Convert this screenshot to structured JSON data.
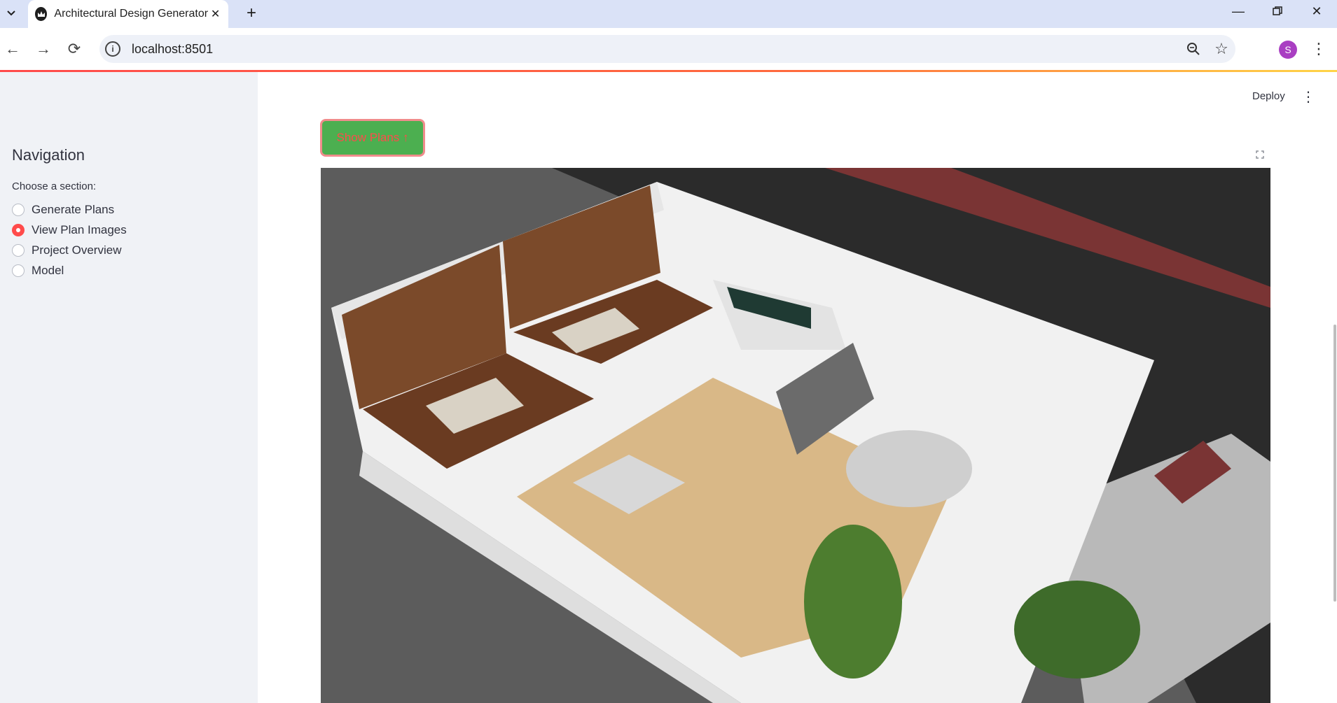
{
  "browser": {
    "tab_title": "Architectural Design Generator",
    "url": "localhost:8501",
    "profile_initial": "S"
  },
  "sidebar": {
    "title": "Navigation",
    "radio_label": "Choose a section:",
    "options": [
      {
        "label": "Generate Plans",
        "selected": false
      },
      {
        "label": "View Plan Images",
        "selected": true
      },
      {
        "label": "Project Overview",
        "selected": false
      },
      {
        "label": "Model",
        "selected": false
      }
    ]
  },
  "header": {
    "deploy_label": "Deploy"
  },
  "main": {
    "show_button_label": "Show Plans ↑",
    "image_alt": "3D isometric cutaway render of a house floor plan"
  },
  "colors": {
    "accent": "#ff4b4b",
    "button_green": "#4caf50",
    "sidebar_bg": "#f0f2f6",
    "tabbar_bg": "#dae2f7"
  },
  "icons": {
    "tab_list": "chevron-down-icon",
    "favicon": "streamlit-crown-icon",
    "tab_close": "close-icon",
    "new_tab": "plus-icon",
    "back": "arrow-left-icon",
    "forward": "arrow-right-icon",
    "reload": "reload-icon",
    "site_info": "info-icon",
    "zoom": "zoom-icon",
    "bookmark": "star-icon",
    "menu": "kebab-menu-icon",
    "fullscreen": "fullscreen-icon"
  }
}
